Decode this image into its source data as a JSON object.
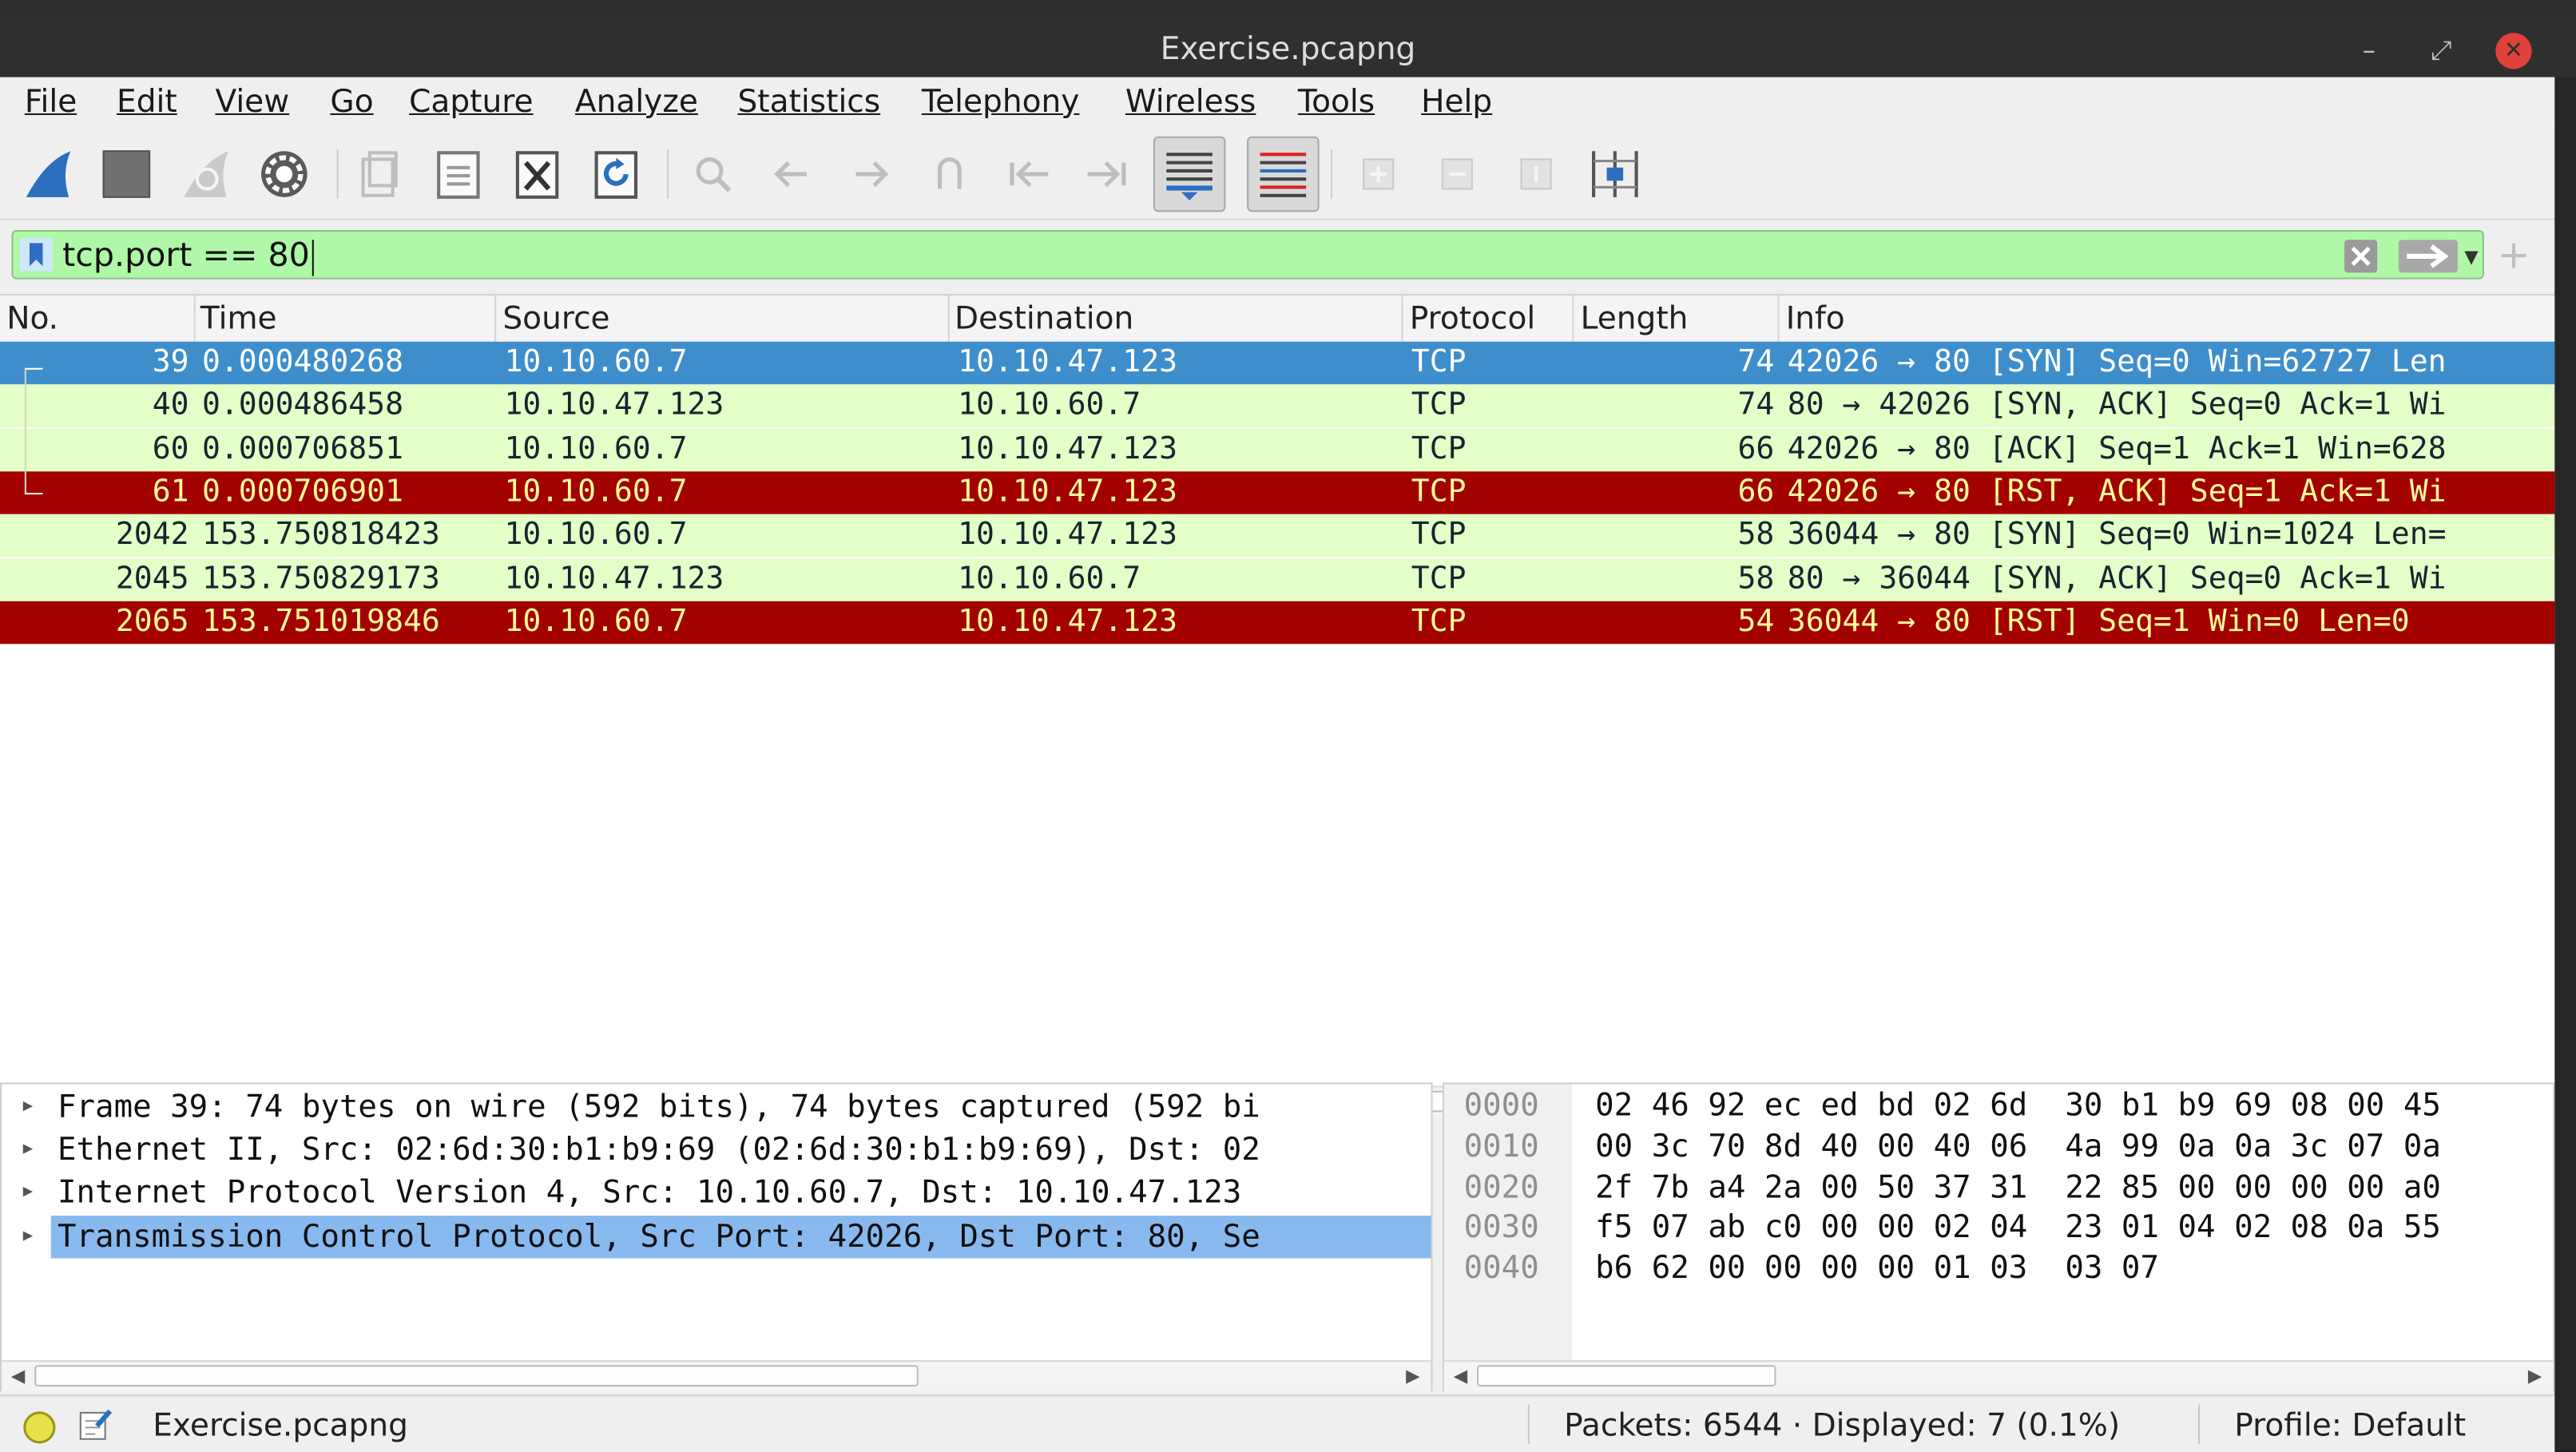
{
  "window": {
    "title": "Exercise.pcapng"
  },
  "menu": [
    "File",
    "Edit",
    "View",
    "Go",
    "Capture",
    "Analyze",
    "Statistics",
    "Telephony",
    "Wireless",
    "Tools",
    "Help"
  ],
  "toolbar_icons": [
    "shark-fin-start",
    "stop-square",
    "restart-shark",
    "gear-options",
    "open-file",
    "save-file",
    "close-file",
    "reload-file",
    "find",
    "back",
    "forward",
    "go-to",
    "first",
    "last",
    "autoscroll",
    "colorize",
    "zoom-in",
    "zoom-out",
    "normal-size",
    "resize-columns"
  ],
  "filter": {
    "value": "tcp.port == 80"
  },
  "columns": [
    "No.",
    "Time",
    "Source",
    "Destination",
    "Protocol",
    "Length",
    "Info"
  ],
  "packets": [
    {
      "no": "39",
      "time": "0.000480268",
      "src": "10.10.60.7",
      "dst": "10.10.47.123",
      "proto": "TCP",
      "len": "74",
      "info": "42026 → 80 [SYN] Seq=0 Win=62727 Len",
      "style": "sel"
    },
    {
      "no": "40",
      "time": "0.000486458",
      "src": "10.10.47.123",
      "dst": "10.10.60.7",
      "proto": "TCP",
      "len": "74",
      "info": "80 → 42026 [SYN, ACK] Seq=0 Ack=1 Wi",
      "style": "green"
    },
    {
      "no": "60",
      "time": "0.000706851",
      "src": "10.10.60.7",
      "dst": "10.10.47.123",
      "proto": "TCP",
      "len": "66",
      "info": "42026 → 80 [ACK] Seq=1 Ack=1 Win=628",
      "style": "green"
    },
    {
      "no": "61",
      "time": "0.000706901",
      "src": "10.10.60.7",
      "dst": "10.10.47.123",
      "proto": "TCP",
      "len": "66",
      "info": "42026 → 80 [RST, ACK] Seq=1 Ack=1 Wi",
      "style": "red"
    },
    {
      "no": "2042",
      "time": "153.750818423",
      "src": "10.10.60.7",
      "dst": "10.10.47.123",
      "proto": "TCP",
      "len": "58",
      "info": "36044 → 80 [SYN] Seq=0 Win=1024 Len=",
      "style": "green"
    },
    {
      "no": "2045",
      "time": "153.750829173",
      "src": "10.10.47.123",
      "dst": "10.10.60.7",
      "proto": "TCP",
      "len": "58",
      "info": "80 → 36044 [SYN, ACK] Seq=0 Ack=1 Wi",
      "style": "green"
    },
    {
      "no": "2065",
      "time": "153.751019846",
      "src": "10.10.60.7",
      "dst": "10.10.47.123",
      "proto": "TCP",
      "len": "54",
      "info": "36044 → 80 [RST] Seq=1 Win=0 Len=0",
      "style": "red"
    }
  ],
  "details": [
    {
      "text": "Frame 39: 74 bytes on wire (592 bits), 74 bytes captured (592 bi",
      "selected": false
    },
    {
      "text": "Ethernet II, Src: 02:6d:30:b1:b9:69 (02:6d:30:b1:b9:69), Dst: 02",
      "selected": false
    },
    {
      "text": "Internet Protocol Version 4, Src: 10.10.60.7, Dst: 10.10.47.123",
      "selected": false
    },
    {
      "text": "Transmission Control Protocol, Src Port: 42026, Dst Port: 80, Se",
      "selected": true
    }
  ],
  "bytes": [
    {
      "off": "0000",
      "hex": "02 46 92 ec ed bd 02 6d  30 b1 b9 69 08 00 45"
    },
    {
      "off": "0010",
      "hex": "00 3c 70 8d 40 00 40 06  4a 99 0a 0a 3c 07 0a"
    },
    {
      "off": "0020",
      "hex": "2f 7b a4 2a 00 50 37 31  22 85 00 00 00 00 a0"
    },
    {
      "off": "0030",
      "hex": "f5 07 ab c0 00 00 02 04  23 01 04 02 08 0a 55"
    },
    {
      "off": "0040",
      "hex": "b6 62 00 00 00 00 01 03  03 07"
    }
  ],
  "status": {
    "file": "Exercise.pcapng",
    "packets": "Packets: 6544 · Displayed: 7 (0.1%)",
    "profile": "Profile: Default"
  },
  "colors": {
    "selected": "#3e8ecb",
    "green": "#e4ffc7",
    "red": "#a30000",
    "filter_ok": "#aff8a7"
  }
}
